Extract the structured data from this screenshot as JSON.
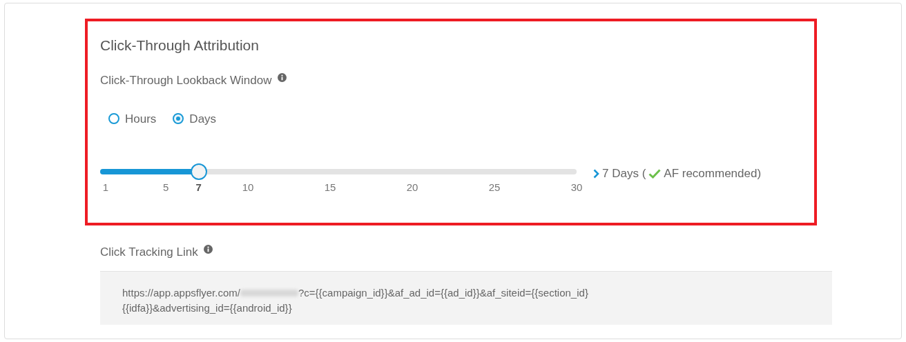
{
  "section": {
    "title": "Click-Through Attribution",
    "field_label": "Click-Through Lookback Window",
    "units": [
      {
        "label": "Hours",
        "selected": false
      },
      {
        "label": "Days",
        "selected": true
      }
    ],
    "slider": {
      "level": 0.207,
      "ticks": [
        {
          "label": "1",
          "selected": false
        },
        {
          "label": "5",
          "selected": false
        },
        {
          "label": "7",
          "selected": true
        },
        {
          "label": "10",
          "selected": false
        },
        {
          "label": "15",
          "selected": false
        },
        {
          "label": "20",
          "selected": false
        },
        {
          "label": "25",
          "selected": false
        },
        {
          "label": "30",
          "selected": false
        }
      ],
      "reading_value": "7 Days (",
      "reading_note": "AF recommended)"
    }
  },
  "tracking_link": {
    "label": "Click Tracking Link",
    "url_start": "https://app.appsflyer.com/",
    "url_rest": "?c={{campaign_id}}&af_ad_id={{ad_id}}&af_siteid={{section_id}",
    "url_line_2": "{{idfa}}&advertising_id={{android_id}}"
  }
}
